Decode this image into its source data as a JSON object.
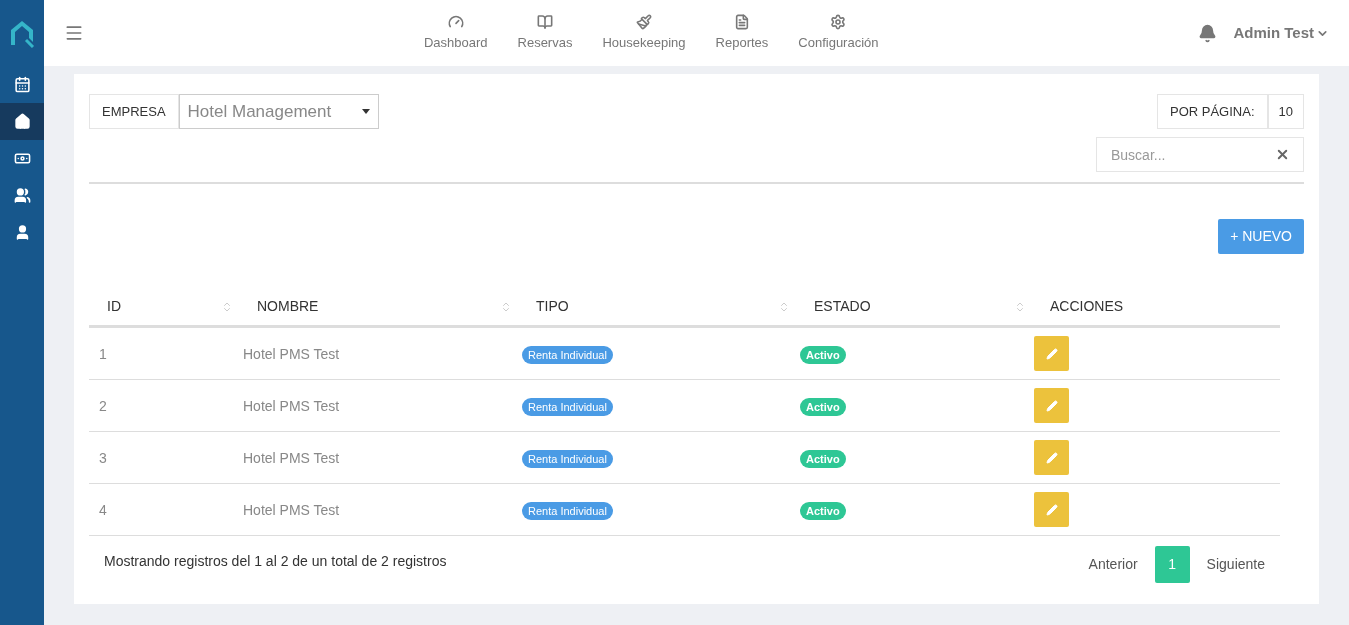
{
  "sidebar": {
    "items": [
      {
        "kind": "calendar",
        "selected": false
      },
      {
        "kind": "home",
        "selected": true
      },
      {
        "kind": "money",
        "selected": false
      },
      {
        "kind": "users",
        "selected": false
      },
      {
        "kind": "user",
        "selected": false
      }
    ]
  },
  "nav": [
    {
      "kind": "gauge",
      "label": "Dashboard"
    },
    {
      "kind": "book",
      "label": "Reservas"
    },
    {
      "kind": "brush",
      "label": "Housekeeping"
    },
    {
      "kind": "file",
      "label": "Reportes"
    },
    {
      "kind": "gear",
      "label": "Configuración"
    }
  ],
  "user": {
    "name": "Admin Test"
  },
  "filter": {
    "label": "EMPRESA",
    "value": "Hotel Management"
  },
  "per_page": {
    "label": "POR PÁGINA:",
    "value": "10"
  },
  "search": {
    "placeholder": "Buscar..."
  },
  "new_button": "+ NUEVO",
  "table": {
    "columns": [
      {
        "label": "ID",
        "sortable": true
      },
      {
        "label": "NOMBRE",
        "sortable": true
      },
      {
        "label": "TIPO",
        "sortable": true
      },
      {
        "label": "ESTADO",
        "sortable": true
      },
      {
        "label": "ACCIONES",
        "sortable": false
      }
    ],
    "rows": [
      {
        "id": "1",
        "nombre": "Hotel PMS Test",
        "tipo": "Renta Individual",
        "estado": "Activo"
      },
      {
        "id": "2",
        "nombre": "Hotel PMS Test",
        "tipo": "Renta Individual",
        "estado": "Activo"
      },
      {
        "id": "3",
        "nombre": "Hotel PMS Test",
        "tipo": "Renta Individual",
        "estado": "Activo"
      },
      {
        "id": "4",
        "nombre": "Hotel PMS Test",
        "tipo": "Renta Individual",
        "estado": "Activo"
      }
    ]
  },
  "footer": {
    "summary": "Mostrando registros del 1 al 2 de un total de 2 registros"
  },
  "pagination": {
    "previous": "Anterior",
    "next": "Siguiente",
    "pages": [
      {
        "label": "1",
        "selected": true
      }
    ]
  }
}
